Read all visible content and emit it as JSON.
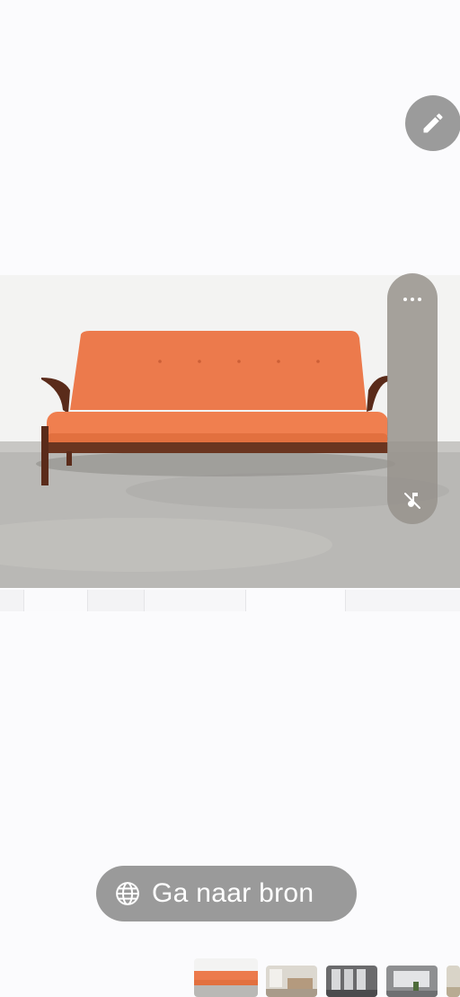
{
  "actions": {
    "edit_icon": "pencil-icon",
    "more_icon": "more-horizontal-icon",
    "mute_icon": "music-off-icon",
    "source_icon": "globe-icon",
    "source_label": "Ga naar bron"
  },
  "image": {
    "description_icon": "sofa-photo"
  },
  "thumbnails": [
    {
      "name": "thumb-sofa-orange",
      "active": true
    },
    {
      "name": "thumb-room-1",
      "active": false
    },
    {
      "name": "thumb-room-2",
      "active": false
    },
    {
      "name": "thumb-room-3",
      "active": false
    },
    {
      "name": "thumb-room-4",
      "active": false
    }
  ]
}
